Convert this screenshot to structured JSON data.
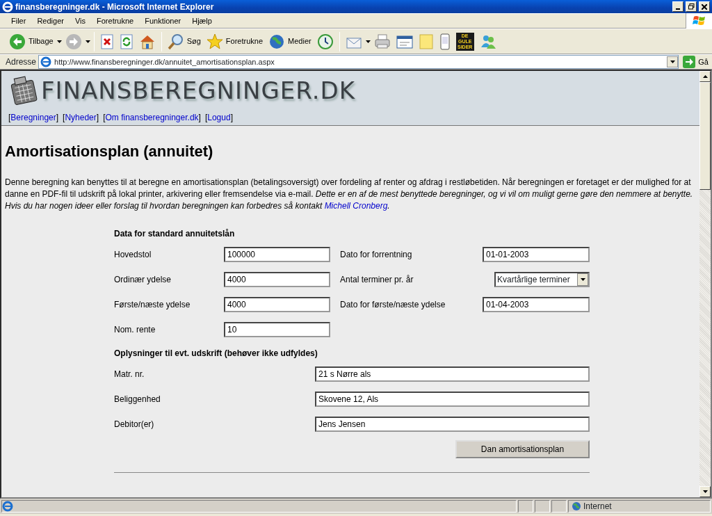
{
  "window": {
    "title": "finansberegninger.dk - Microsoft Internet Explorer"
  },
  "menu": [
    "Filer",
    "Rediger",
    "Vis",
    "Foretrukne",
    "Funktioner",
    "Hjælp"
  ],
  "toolbar": [
    {
      "kind": "back",
      "label": "Tilbage",
      "has_menu": true
    },
    {
      "kind": "forward",
      "has_menu": true
    },
    {
      "kind": "sep"
    },
    {
      "kind": "stop"
    },
    {
      "kind": "refresh"
    },
    {
      "kind": "home"
    },
    {
      "kind": "sep"
    },
    {
      "kind": "search",
      "label": "Søg"
    },
    {
      "kind": "favorites",
      "label": "Foretrukne"
    },
    {
      "kind": "media",
      "label": "Medier"
    },
    {
      "kind": "history"
    },
    {
      "kind": "sep"
    },
    {
      "kind": "mail",
      "has_menu": true
    },
    {
      "kind": "print"
    },
    {
      "kind": "edit"
    },
    {
      "kind": "note"
    },
    {
      "kind": "phone"
    },
    {
      "kind": "tile",
      "label": "DE GULE SIDER"
    },
    {
      "kind": "people"
    }
  ],
  "address": {
    "label": "Adresse",
    "url": "http://www.finansberegninger.dk/annuitet_amortisationsplan.aspx",
    "go": "Gå"
  },
  "site": {
    "logo": "FINANSBEREGNINGER.DK",
    "nav": [
      {
        "open": "[",
        "label": "Beregninger",
        "close": "]"
      },
      {
        "open": "[",
        "label": "Nyheder",
        "close": "]"
      },
      {
        "open": "[",
        "label": "Om finansberegninger.dk",
        "close": "]"
      },
      {
        "open": "[",
        "label": "Logud",
        "close": "]"
      }
    ]
  },
  "heading": "Amortisationsplan (annuitet)",
  "intro": {
    "text": "Denne beregning kan benyttes til at beregne en amortisationsplan (betalingsoversigt) over fordeling af renter og afdrag i restløbetiden. Når beregningen er foretaget er der mulighed for at danne en PDF-fil til udskrift på lokal printer, arkivering eller fremsendelse via e-mail. *Dette er en af de mest benyttede beregninger, og vi vil om muligt gerne gøre den nemmere at benytte. Hvis du har nogen ideer eller forslag til hvordan beregningen kan forbedres så kontakt* ",
    "link": "Michell Cronberg",
    "after_link": "."
  },
  "loan_section": {
    "title": "Data for standard annuitetslån",
    "rows": [
      {
        "left": {
          "label": "Hovedstol",
          "value": "100000"
        },
        "right": {
          "label": "Dato for forrentning",
          "kind": "text",
          "value": "01-01-2003"
        }
      },
      {
        "left": {
          "label": "Ordinær ydelse",
          "value": "4000"
        },
        "right": {
          "label": "Antal terminer pr. år",
          "kind": "select",
          "value": "Kvartårlige terminer"
        }
      },
      {
        "left": {
          "label": "Første/næste ydelse",
          "value": "4000"
        },
        "right": {
          "label": "Dato for første/næste ydelse",
          "kind": "text",
          "value": "01-04-2003"
        }
      },
      {
        "left": {
          "label": "Nom. rente",
          "value": "10"
        }
      }
    ]
  },
  "print_section": {
    "title": "Oplysninger til evt. udskrift (behøver ikke udfyldes)",
    "fields": [
      {
        "label": "Matr. nr.",
        "value": "21 s Nørre als"
      },
      {
        "label": "Beliggenhed",
        "value": "Skovene 12, Als"
      },
      {
        "label": "Debitor(er)",
        "value": "Jens Jensen"
      }
    ]
  },
  "submit": "Dan amortisationsplan",
  "status_bar": {
    "zone": "Internet"
  }
}
